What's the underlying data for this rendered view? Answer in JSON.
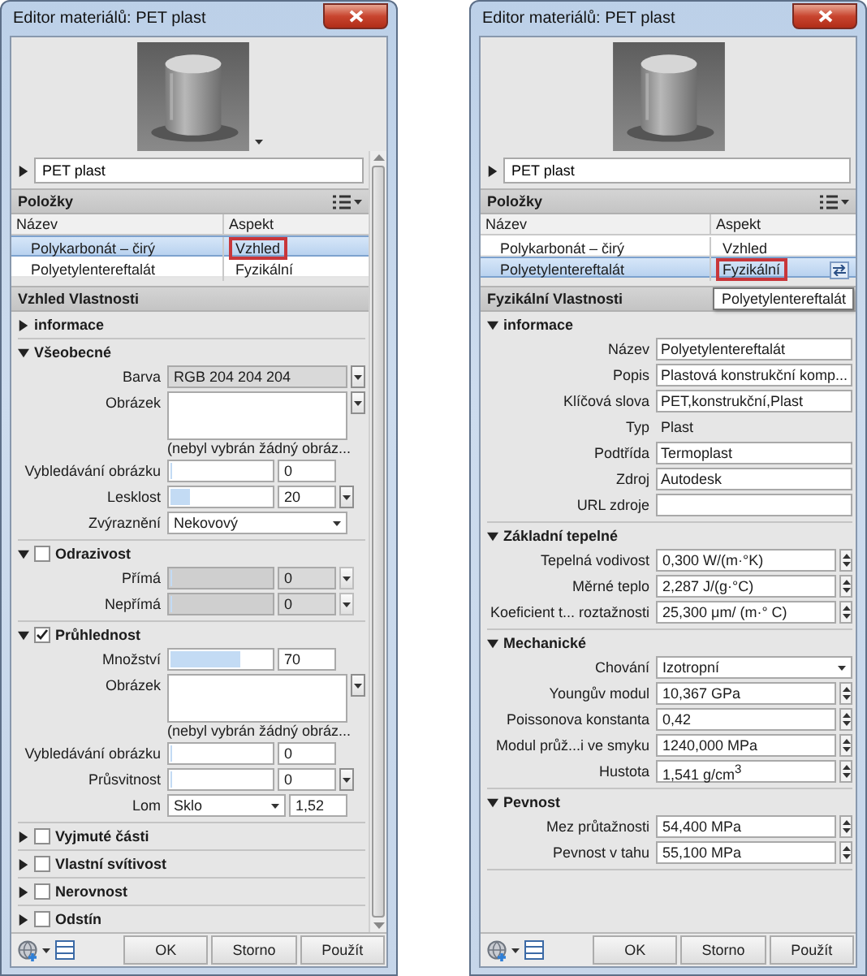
{
  "windows": [
    {
      "title": "Editor materiálů: PET plast",
      "preview_menu": true,
      "scrollbar": true,
      "material_name": "PET plast",
      "items_title": "Položky",
      "columns": [
        "Název",
        "Aspekt"
      ],
      "rows": [
        {
          "name": "Polykarbonát – čirý",
          "aspect": "Vzhled",
          "selected": true,
          "highlighted": true,
          "swap_icon": false
        },
        {
          "name": "Polyetylentereftalát",
          "aspect": "Fyzikální",
          "selected": false,
          "highlighted": false,
          "swap_icon": false
        }
      ],
      "properties_title": "Vzhled Vlastnosti",
      "sections": [
        {
          "kind": "plain",
          "title": "informace",
          "expanded": false
        },
        {
          "kind": "plain",
          "title": "Všeobecné",
          "expanded": true,
          "fields": [
            {
              "kind": "color",
              "label": "Barva",
              "value": "RGB 204 204 204"
            },
            {
              "label": "Obrázek",
              "caption": "(nebyl vybrán žádný obráz..."
            },
            {
              "kind": "slider",
              "label": "Vybledávání obrázku",
              "level": 0,
              "value": "0",
              "menu": false,
              "disabled": false
            },
            {
              "kind": "slider",
              "label": "Lesklost",
              "level": 0.2,
              "value": "20",
              "menu": true,
              "disabled": false
            },
            {
              "kind": "select",
              "label": "Zvýraznění",
              "value": "Nekovový"
            }
          ]
        },
        {
          "kind": "toggle",
          "title": "Odrazivost",
          "expanded": true,
          "checked": false,
          "fields": [
            {
              "kind": "slider",
              "label": "Přímá",
              "level": 0,
              "value": "0",
              "menu": true,
              "disabled": true
            },
            {
              "kind": "slider",
              "label": "Nepřímá",
              "level": 0,
              "value": "0",
              "menu": true,
              "disabled": true
            }
          ]
        },
        {
          "kind": "toggle",
          "title": "Průhlednost",
          "expanded": true,
          "checked": true,
          "fields": [
            {
              "kind": "slider",
              "label": "Množství",
              "level": 0.7,
              "value": "70",
              "menu": false,
              "disabled": false
            },
            {
              "label": "Obrázek",
              "caption": "(nebyl vybrán žádný obráz..."
            },
            {
              "kind": "slider",
              "label": "Vybledávání obrázku",
              "level": 0,
              "value": "0",
              "menu": false,
              "disabled": false
            },
            {
              "kind": "slider",
              "label": "Průsvitnost",
              "level": 0,
              "value": "0",
              "menu": true,
              "disabled": false
            },
            {
              "kind": "select_value",
              "label": "Lom",
              "value": "Sklo",
              "number": "1,52"
            }
          ]
        },
        {
          "kind": "toggle",
          "title": "Vyjmuté části",
          "expanded": false,
          "checked": false
        },
        {
          "kind": "toggle",
          "title": "Vlastní svítivost",
          "expanded": false,
          "checked": false
        },
        {
          "kind": "toggle",
          "title": "Nerovnost",
          "expanded": false,
          "checked": false
        },
        {
          "kind": "toggle",
          "title": "Odstín",
          "expanded": false,
          "checked": false
        }
      ],
      "buttons": [
        "OK",
        "Storno",
        "Použít"
      ]
    },
    {
      "title": "Editor materiálů: PET plast",
      "preview_menu": false,
      "scrollbar": false,
      "material_name": "PET plast",
      "items_title": "Položky",
      "columns": [
        "Název",
        "Aspekt"
      ],
      "rows": [
        {
          "name": "Polykarbonát – čirý",
          "aspect": "Vzhled",
          "selected": false,
          "highlighted": false,
          "swap_icon": false
        },
        {
          "name": "Polyetylentereftalát",
          "aspect": "Fyzikální",
          "selected": true,
          "highlighted": true,
          "swap_icon": true
        }
      ],
      "tooltip": "Polyetylentereftalát",
      "properties_title": "Fyzikální Vlastnosti",
      "sections": [
        {
          "kind": "plain",
          "title": "informace",
          "expanded": true,
          "fields": [
            {
              "kind": "text",
              "label": "Název",
              "value": "Polyetylentereftalát"
            },
            {
              "kind": "text",
              "label": "Popis",
              "value": "Plastová konstrukční komp..."
            },
            {
              "kind": "text",
              "label": "Klíčová slova",
              "value": "PET,konstrukční,Plast"
            },
            {
              "kind": "plain",
              "label": "Typ",
              "value": "Plast"
            },
            {
              "kind": "text",
              "label": "Podtřída",
              "value": "Termoplast"
            },
            {
              "kind": "text",
              "label": "Zdroj",
              "value": "Autodesk"
            },
            {
              "kind": "text",
              "label": "URL zdroje"
            }
          ]
        },
        {
          "kind": "plain",
          "title": "Základní tepelné",
          "expanded": true,
          "fields": [
            {
              "kind": "spinner",
              "label": "Tepelná vodivost",
              "value": "0,300 W/(m·°K)"
            },
            {
              "kind": "spinner",
              "label": "Měrné teplo",
              "value": "2,287 J/(g·°C)"
            },
            {
              "kind": "spinner",
              "label": "Koeficient t... roztažnosti",
              "value": "25,300 μm/ (m·° C)"
            }
          ]
        },
        {
          "kind": "plain",
          "title": "Mechanické",
          "expanded": true,
          "fields": [
            {
              "kind": "select",
              "label": "Chování",
              "value": "Izotropní"
            },
            {
              "kind": "spinner",
              "label": "Youngův modul",
              "value": "10,367 GPa"
            },
            {
              "kind": "spinner",
              "label": "Poissonova konstanta",
              "value": "0,42"
            },
            {
              "kind": "spinner",
              "label": "Modul průž...i ve smyku",
              "value": "1240,000 MPa"
            },
            {
              "kind": "spinner",
              "label": "Hustota",
              "value": "1,541 g/cm$^{3}$"
            }
          ]
        },
        {
          "kind": "plain",
          "title": "Pevnost",
          "expanded": true,
          "fields": [
            {
              "kind": "spinner",
              "label": "Mez průtažnosti",
              "value": "54,400 MPa"
            },
            {
              "kind": "spinner",
              "label": "Pevnost v tahu",
              "value": "55,100 MPa"
            }
          ]
        }
      ],
      "buttons": [
        "OK",
        "Storno",
        "Použít"
      ]
    }
  ]
}
